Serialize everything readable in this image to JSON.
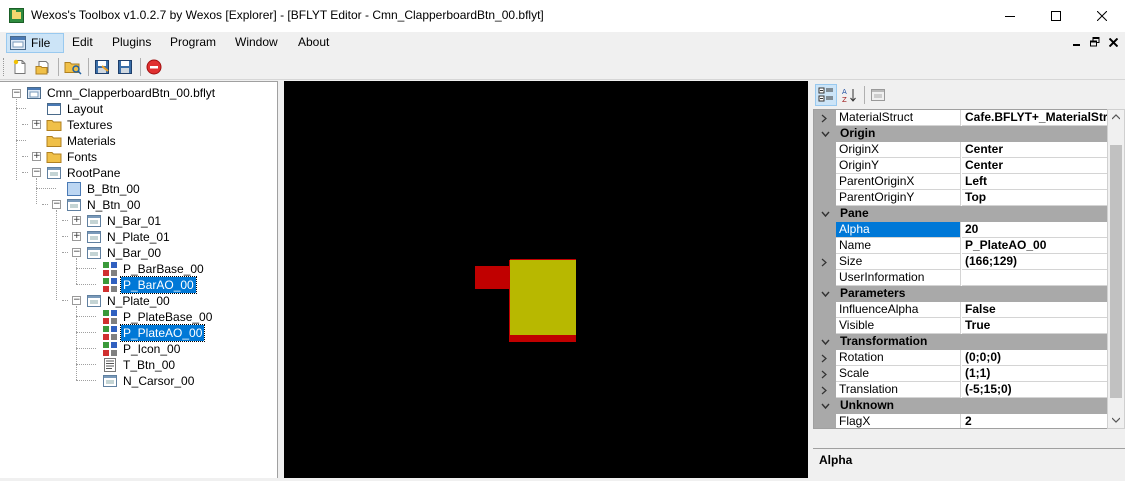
{
  "window": {
    "title": "Wexos's Toolbox v1.0.2.7 by Wexos [Explorer] - [BFLYT Editor - Cmn_ClapperboardBtn_00.bflyt]",
    "controls": [
      "minimize",
      "maximize",
      "close"
    ]
  },
  "menu": {
    "items": [
      "File",
      "Edit",
      "Plugins",
      "Program",
      "Window",
      "About"
    ]
  },
  "toolbar": {
    "buttons": [
      "new-file-icon",
      "new-folder-icon",
      "open-folder-icon",
      "save-icon",
      "save-all-icon",
      "stop-icon"
    ]
  },
  "tree": {
    "nodes": [
      {
        "label": "Cmn_ClapperboardBtn_00.bflyt",
        "icon": "layout-file-icon"
      },
      {
        "label": "Layout",
        "icon": "layout-icon"
      },
      {
        "label": "Textures",
        "icon": "folder-icon"
      },
      {
        "label": "Materials",
        "icon": "folder-icon"
      },
      {
        "label": "Fonts",
        "icon": "folder-icon"
      },
      {
        "label": "RootPane",
        "icon": "pane-icon"
      },
      {
        "label": "B_Btn_00",
        "icon": "bounding-icon"
      },
      {
        "label": "N_Btn_00",
        "icon": "pane-icon"
      },
      {
        "label": "N_Bar_01",
        "icon": "pane-icon"
      },
      {
        "label": "N_Plate_01",
        "icon": "pane-icon"
      },
      {
        "label": "N_Bar_00",
        "icon": "pane-icon"
      },
      {
        "label": "P_BarBase_00",
        "icon": "picture-icon"
      },
      {
        "label": "P_BarAO_00",
        "icon": "picture-icon"
      },
      {
        "label": "N_Plate_00",
        "icon": "pane-icon"
      },
      {
        "label": "P_PlateBase_00",
        "icon": "picture-icon"
      },
      {
        "label": "P_PlateAO_00",
        "icon": "picture-icon"
      },
      {
        "label": "P_Icon_00",
        "icon": "picture-icon"
      },
      {
        "label": "T_Btn_00",
        "icon": "text-icon"
      },
      {
        "label": "N_Carsor_00",
        "icon": "pane-icon"
      }
    ]
  },
  "viewport": {
    "background": "#000000",
    "plate_color": "#b8b800",
    "accent_color": "#c00000"
  },
  "properties": {
    "rows": [
      {
        "type": "prop",
        "name": "MaterialStruct",
        "value": "Cafe.BFLYT+_MaterialStr",
        "expandable": true
      },
      {
        "type": "cat",
        "name": "Origin"
      },
      {
        "type": "prop",
        "name": "OriginX",
        "value": "Center"
      },
      {
        "type": "prop",
        "name": "OriginY",
        "value": "Center"
      },
      {
        "type": "prop",
        "name": "ParentOriginX",
        "value": "Left"
      },
      {
        "type": "prop",
        "name": "ParentOriginY",
        "value": "Top"
      },
      {
        "type": "cat",
        "name": "Pane"
      },
      {
        "type": "prop",
        "name": "Alpha",
        "value": "20",
        "selected": true
      },
      {
        "type": "prop",
        "name": "Name",
        "value": "P_PlateAO_00"
      },
      {
        "type": "prop",
        "name": "Size",
        "value": "(166;129)",
        "expandable": true
      },
      {
        "type": "prop",
        "name": "UserInformation",
        "value": ""
      },
      {
        "type": "cat",
        "name": "Parameters"
      },
      {
        "type": "prop",
        "name": "InfluenceAlpha",
        "value": "False"
      },
      {
        "type": "prop",
        "name": "Visible",
        "value": "True"
      },
      {
        "type": "cat",
        "name": "Transformation"
      },
      {
        "type": "prop",
        "name": "Rotation",
        "value": "(0;0;0)",
        "expandable": true
      },
      {
        "type": "prop",
        "name": "Scale",
        "value": "(1;1)",
        "expandable": true
      },
      {
        "type": "prop",
        "name": "Translation",
        "value": "(-5;15;0)",
        "expandable": true
      },
      {
        "type": "cat",
        "name": "Unknown"
      },
      {
        "type": "prop",
        "name": "FlagX",
        "value": "2"
      }
    ],
    "description_title": "Alpha"
  }
}
